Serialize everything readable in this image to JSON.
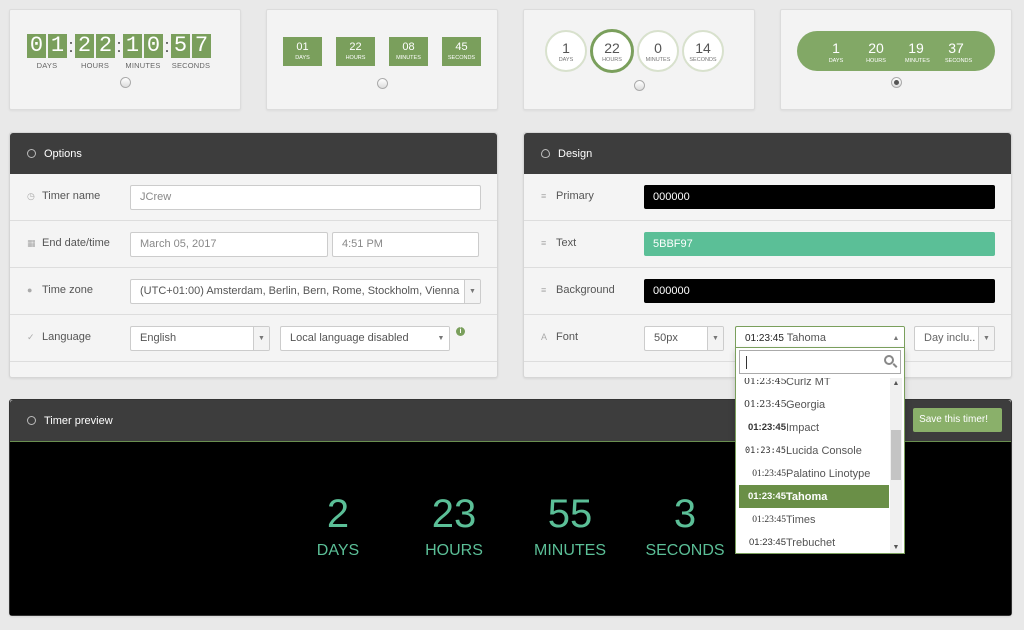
{
  "templates": [
    {
      "units": [
        {
          "digits": "01",
          "label": "DAYS"
        },
        {
          "digits": "22",
          "label": "HOURS"
        },
        {
          "digits": "10",
          "label": "MINUTES"
        },
        {
          "digits": "57",
          "label": "SECONDS"
        }
      ]
    },
    {
      "units": [
        {
          "value": "01",
          "label": "DAYS"
        },
        {
          "value": "22",
          "label": "HOURS"
        },
        {
          "value": "08",
          "label": "MINUTES"
        },
        {
          "value": "45",
          "label": "SECONDS"
        }
      ]
    },
    {
      "units": [
        {
          "value": "1",
          "label": "DAYS"
        },
        {
          "value": "22",
          "label": "HOURS"
        },
        {
          "value": "0",
          "label": "MINUTES"
        },
        {
          "value": "14",
          "label": "SECONDS"
        }
      ]
    },
    {
      "units": [
        {
          "value": "1",
          "label": "DAYS"
        },
        {
          "value": "20",
          "label": "HOURS"
        },
        {
          "value": "19",
          "label": "MINUTES"
        },
        {
          "value": "37",
          "label": "SECONDS"
        }
      ]
    }
  ],
  "selected_template": 4,
  "options": {
    "title": "Options",
    "timer_name_label": "Timer name",
    "timer_name_value": "JCrew",
    "end_label": "End date/time",
    "end_date": "March 05, 2017",
    "end_time": "4:51 PM",
    "timezone_label": "Time zone",
    "timezone_value": "(UTC+01:00) Amsterdam, Berlin, Bern, Rome, Stockholm, Vienna",
    "language_label": "Language",
    "language_value": "English",
    "local_language_value": "Local language disabled"
  },
  "design": {
    "title": "Design",
    "primary_label": "Primary",
    "primary_value": "000000",
    "text_label": "Text",
    "text_value": "5BBF97",
    "background_label": "Background",
    "background_value": "000000",
    "font_label": "Font",
    "font_size": "50px",
    "font_sample": "01:23:45",
    "font_name": "Tahoma",
    "days_option": "Day inclu.."
  },
  "font_list": [
    {
      "sample": "01:23:45",
      "name": "Curlz MT"
    },
    {
      "sample": "01:23:45",
      "name": "Georgia"
    },
    {
      "sample": "01:23:45",
      "name": "Impact"
    },
    {
      "sample": "01:23:45",
      "name": "Lucida Console"
    },
    {
      "sample": "01:23:45",
      "name": "Palatino Linotype"
    },
    {
      "sample": "01:23:45",
      "name": "Tahoma"
    },
    {
      "sample": "01:23:45",
      "name": "Times"
    },
    {
      "sample": "01:23:45",
      "name": "Trebuchet"
    }
  ],
  "preview": {
    "title": "Timer preview",
    "save_label": "Save this timer!",
    "units": [
      {
        "value": "2",
        "label": "DAYS"
      },
      {
        "value": "23",
        "label": "HOURS"
      },
      {
        "value": "55",
        "label": "MINUTES"
      },
      {
        "value": "3",
        "label": "SECONDS"
      }
    ]
  },
  "colors": {
    "accent": "#7a9f5c",
    "text": "#5bbf97",
    "header": "#3d3d3d"
  }
}
